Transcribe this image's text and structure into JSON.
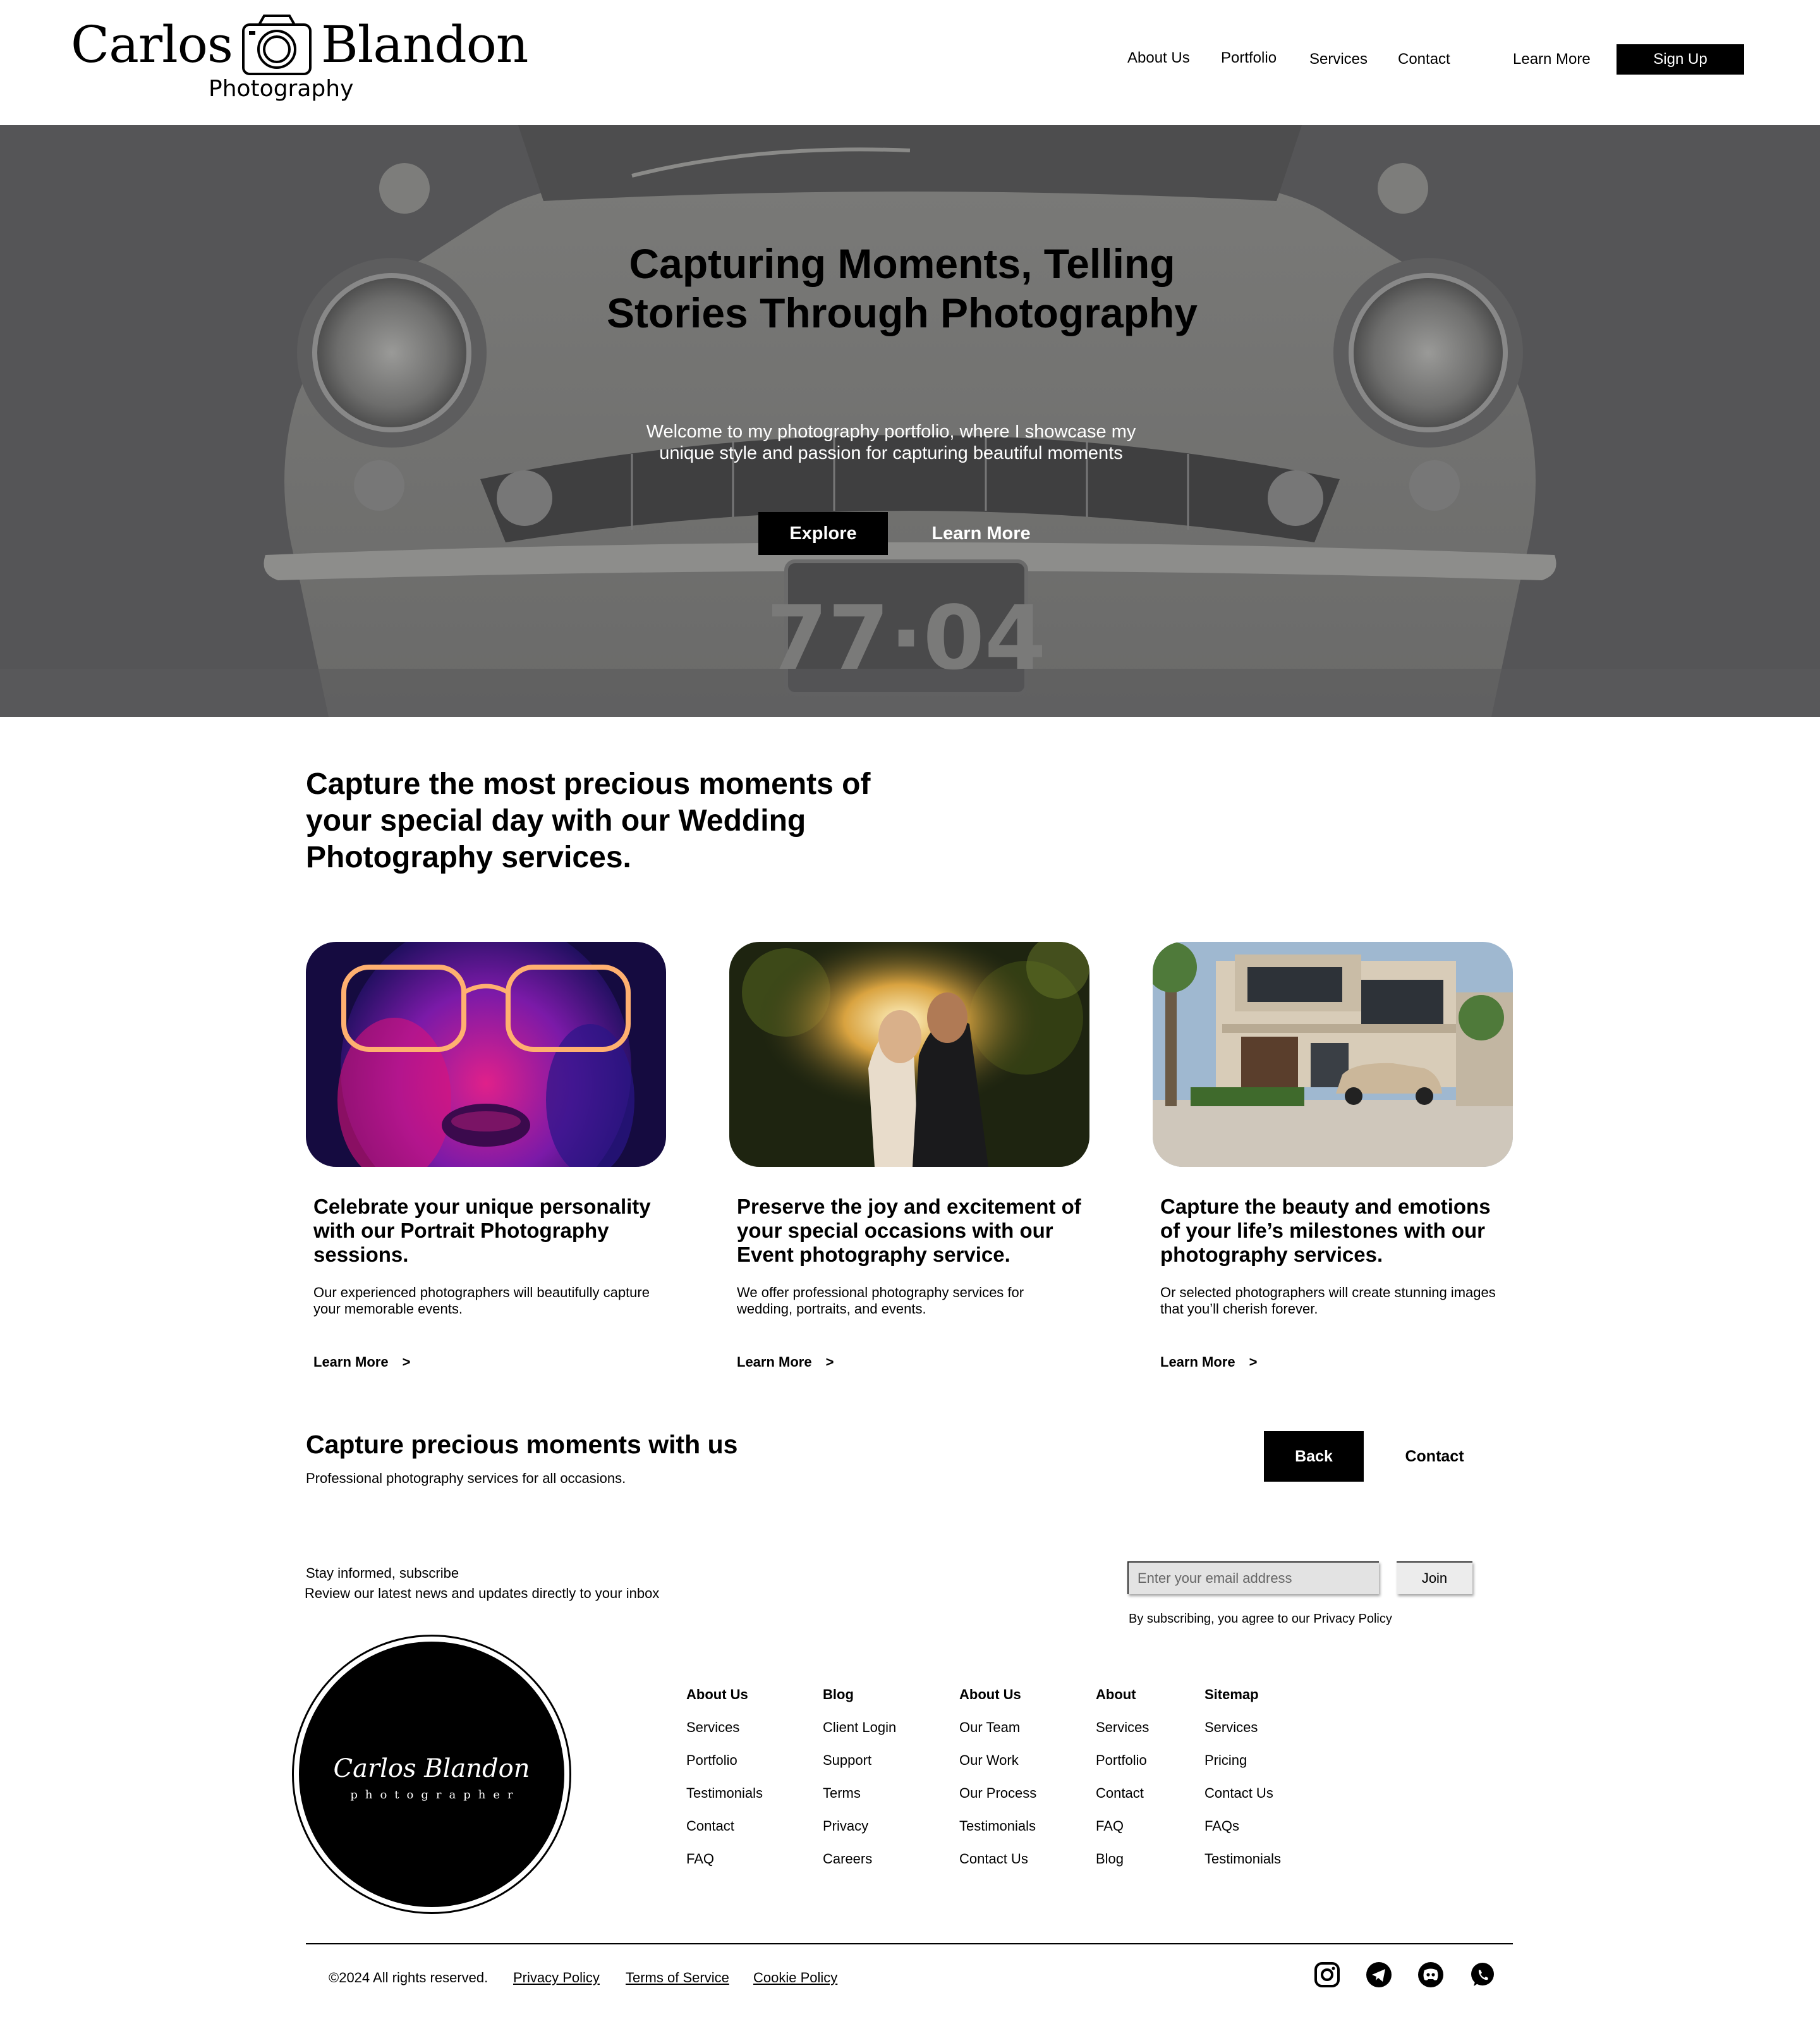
{
  "brand": {
    "first_name": "Carlos",
    "last_name": "Blandon",
    "tagline": "Photography"
  },
  "nav": {
    "links": [
      "About Us",
      "Portfolio",
      "Services",
      "Contact",
      "Learn More"
    ],
    "signup_label": "Sign Up"
  },
  "hero": {
    "title": "Capturing Moments, Telling Stories Through Photography",
    "text": "Welcome to my photography portfolio, where I showcase my unique style and passion for capturing beautiful moments",
    "explore_label": "Explore",
    "learn_label": "Learn More",
    "plate_number": "77·04"
  },
  "intro": {
    "heading": "Capture the most precious moments of your special day with our Wedding Photography services."
  },
  "cards": [
    {
      "title": "Celebrate your unique personality with our Portrait Photography sessions.",
      "text": "Our experienced photographers will beautifully capture your memorable events.",
      "link": "Learn More",
      "chevron": ">"
    },
    {
      "title": "Preserve the joy and excitement of your special occasions with our Event photography service.",
      "text": "We offer professional photography services for wedding, portraits, and events.",
      "link": "Learn More",
      "chevron": ">"
    },
    {
      "title": "Capture the beauty and emotions of your life’s milestones with our photography services.",
      "text": "Or selected photographers will create stunning images that you’ll cherish forever.",
      "link": "Learn More",
      "chevron": ">"
    }
  ],
  "cta": {
    "title": "Capture precious moments with us",
    "subtitle": "Professional photography services for all occasions.",
    "back_label": "Back",
    "contact_label": "Contact"
  },
  "subscribe": {
    "title": "Stay informed, subscribe",
    "text": "Review our latest news and updates directly to your inbox",
    "placeholder": "Enter your email address",
    "join_label": "Join",
    "note": "By subscribing, you agree to our Privacy Policy"
  },
  "footer": {
    "logo_name": "Carlos Blandon",
    "logo_sub": "photographer",
    "columns": [
      {
        "heading": "About Us",
        "links": [
          "Services",
          "Portfolio",
          "Testimonials",
          "Contact",
          "FAQ"
        ]
      },
      {
        "heading": "Blog",
        "links": [
          "Client Login",
          "Support",
          "Terms",
          "Privacy",
          "Careers"
        ]
      },
      {
        "heading": "About Us",
        "links": [
          "Our Team",
          "Our Work",
          "Our Process",
          "Testimonials",
          "Contact Us"
        ]
      },
      {
        "heading": "About",
        "links": [
          "Services",
          "Portfolio",
          "Contact",
          "FAQ",
          "Blog"
        ]
      },
      {
        "heading": "Sitemap",
        "links": [
          "Services",
          "Pricing",
          "Contact Us",
          "FAQs",
          "Testimonials"
        ]
      }
    ],
    "copyright": "©2024 All rights reserved.",
    "legal_links": [
      "Privacy Policy",
      "Terms of Service",
      "Cookie Policy"
    ],
    "social_icons": [
      "instagram-icon",
      "telegram-icon",
      "discord-icon",
      "whatsapp-icon"
    ]
  }
}
